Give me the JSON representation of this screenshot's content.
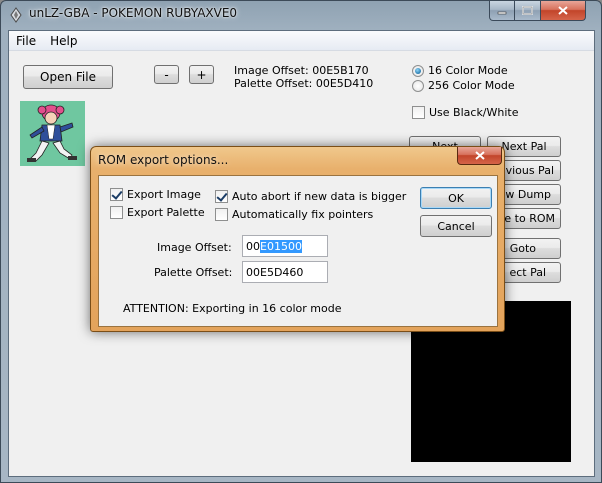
{
  "window": {
    "title": "unLZ-GBA - POKEMON RUBYAXVE0"
  },
  "menu": {
    "items": [
      "File",
      "Help"
    ]
  },
  "toolbar": {
    "open_file": "Open File",
    "minus": "-",
    "plus": "+",
    "image_offset": "Image Offset: 00E5B170",
    "palette_offset": "Palette Offset: 00E5D410"
  },
  "color_mode": {
    "options": [
      "16 Color Mode",
      "256 Color Mode"
    ],
    "selected": "16 Color Mode"
  },
  "use_bw": {
    "label": "Use Black/White",
    "checked": false
  },
  "right_buttons": [
    "Next",
    "Next Pal",
    "revious Pal",
    "w Dump",
    "e to ROM",
    "Goto",
    "ect Pal"
  ],
  "palette_colors": [
    "#a9b7d9",
    "#c7d0e6",
    "#7f8fb8",
    "#d070a0",
    "#f0a0c8",
    "#6a6a9a",
    "#ffffff"
  ],
  "dialog": {
    "title": "ROM export options...",
    "export_image": {
      "label": "Export Image",
      "checked": true
    },
    "export_palette": {
      "label": "Export Palette",
      "checked": false
    },
    "auto_abort": {
      "label": "Auto abort if new data is bigger",
      "checked": true
    },
    "auto_fix": {
      "label": "Automatically fix pointers",
      "checked": false
    },
    "image_offset_label": "Image Offset:",
    "image_offset_prefix": "00",
    "image_offset_selected": "E01500",
    "palette_offset_label": "Palette Offset:",
    "palette_offset_value": "00E5D460",
    "attention": "ATTENTION: Exporting in 16 color mode",
    "ok": "OK",
    "cancel": "Cancel"
  }
}
